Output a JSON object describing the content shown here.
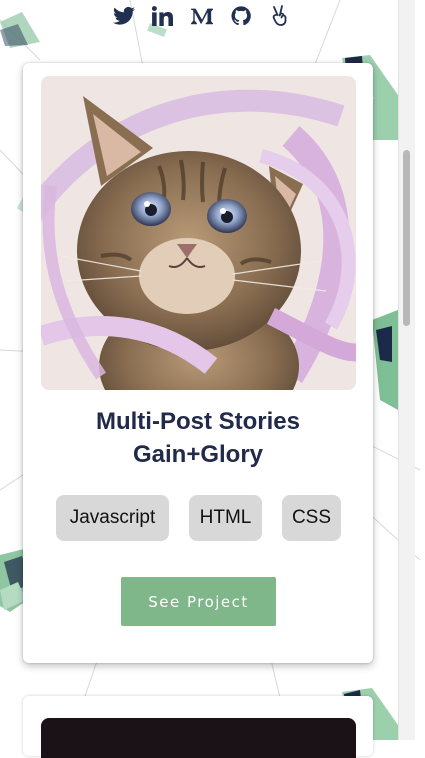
{
  "social_links": [
    {
      "icon": "twitter-icon"
    },
    {
      "icon": "linkedin-icon"
    },
    {
      "icon": "medium-icon"
    },
    {
      "icon": "github-icon"
    },
    {
      "icon": "peace-hand-icon"
    }
  ],
  "project_card": {
    "title_line1": "Multi-Post Stories",
    "title_line2": "Gain+Glory",
    "tags": [
      "Javascript",
      "HTML",
      "CSS"
    ],
    "button_label": "See Project"
  },
  "colors": {
    "accent_green": "#7fb68a",
    "title_navy": "#222a4a",
    "tag_gray": "#d8d8d8",
    "icon_navy": "#22304f"
  }
}
